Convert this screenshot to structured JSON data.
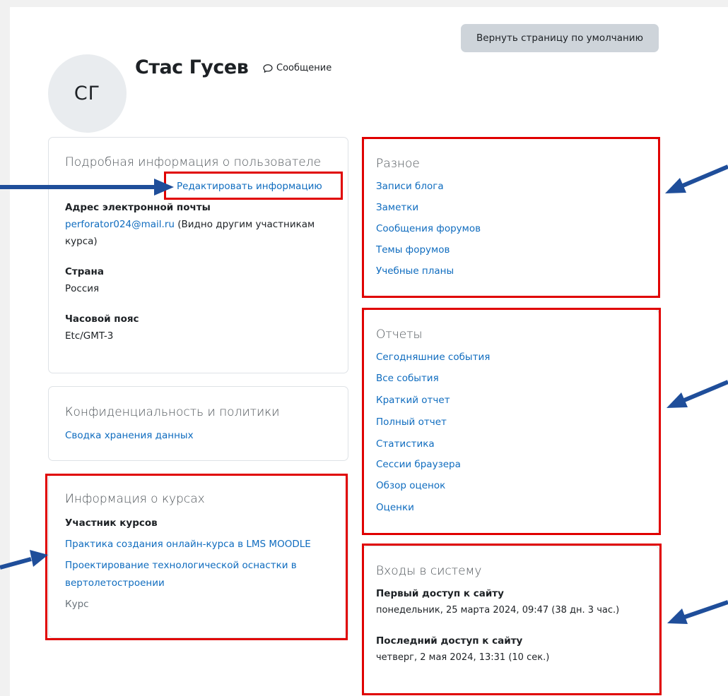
{
  "header": {
    "reset_button": "Вернуть страницу по умолчанию",
    "avatar_initials": "СГ",
    "user_name": "Стас Гусев",
    "message_label": "Сообщение"
  },
  "user_details": {
    "title": "Подробная информация о пользователе",
    "edit_link": "Редактировать информацию",
    "email_label": "Адрес электронной почты",
    "email_value": "perforator024@mail.ru",
    "email_note_line1": " (Видно другим участникам",
    "email_note_line2": "курса)",
    "country_label": "Страна",
    "country_value": "Россия",
    "timezone_label": "Часовой пояс",
    "timezone_value": "Etc/GMT-3"
  },
  "privacy": {
    "title": "Конфиденциальность и политики",
    "data_retention_link": "Сводка хранения данных"
  },
  "course_details": {
    "title": "Информация о курсах",
    "participant_label": "Участник курсов",
    "course1": "Практика создания онлайн-курса в LMS MOODLE",
    "course2_line1": "Проектирование технологической оснастки в",
    "course2_line2": "вертолетостроении",
    "course_label": "Курс"
  },
  "misc": {
    "title": "Разное",
    "items": [
      "Записи блога",
      "Заметки",
      "Сообщения форумов",
      "Темы форумов",
      "Учебные планы"
    ]
  },
  "reports": {
    "title": "Отчеты",
    "items": [
      "Сегодняшние события",
      "Все события",
      "Краткий отчет",
      "Полный отчет",
      "Статистика",
      "Сессии браузера",
      "Обзор оценок",
      "Оценки"
    ]
  },
  "logins": {
    "title": "Входы в систему",
    "first_access_label": "Первый доступ к сайту",
    "first_access_value": "понедельник, 25 марта 2024, 09:47  (38 дн. 3 час.)",
    "last_access_label": "Последний доступ к сайту",
    "last_access_value": "четверг, 2 мая 2024, 13:31  (10 сек.)"
  },
  "colors": {
    "annotation_box": "#e00000",
    "annotation_arrow": "#1f4e9a",
    "link": "#0f6cbf"
  }
}
